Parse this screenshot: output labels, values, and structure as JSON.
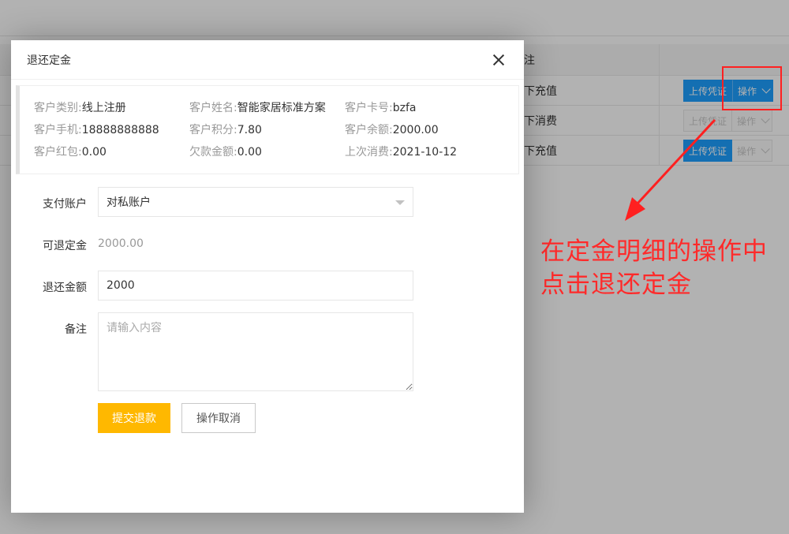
{
  "background": {
    "table_header_text": "注",
    "rows": [
      {
        "type_text": "下充值",
        "upload_label": "上传凭证",
        "op_label": "操作",
        "upload_enabled": true,
        "op_enabled": true
      },
      {
        "type_text": "下消费",
        "upload_label": "上传凭证",
        "op_label": "操作",
        "upload_enabled": false,
        "op_enabled": false
      },
      {
        "type_text": "下充值",
        "upload_label": "上传凭证",
        "op_label": "操作",
        "upload_enabled": true,
        "op_enabled": false
      }
    ]
  },
  "annotation": {
    "line1": "在定金明细的操作中",
    "line2": "点击退还定金",
    "color": "#ff2a2a"
  },
  "modal": {
    "title": "退还定金",
    "info": [
      {
        "label": "客户类别:",
        "value": "线上注册"
      },
      {
        "label": "客户姓名:",
        "value": "智能家居标准方案"
      },
      {
        "label": "客户卡号:",
        "value": "bzfa"
      },
      {
        "label": "客户手机:",
        "value": "18888888888"
      },
      {
        "label": "客户积分:",
        "value": "7.80"
      },
      {
        "label": "客户余额:",
        "value": "2000.00"
      },
      {
        "label": "客户红包:",
        "value": "0.00"
      },
      {
        "label": "欠款金额:",
        "value": "0.00"
      },
      {
        "label": "上次消费:",
        "value": "2021-10-12"
      }
    ],
    "form": {
      "pay_account_label": "支付账户",
      "pay_account_value": "对私账户",
      "refundable_label": "可退定金",
      "refundable_value": "2000.00",
      "refund_amount_label": "退还金额",
      "refund_amount_value": "2000",
      "remark_label": "备注",
      "remark_placeholder": "请输入内容"
    },
    "buttons": {
      "submit_label": "提交退款",
      "cancel_label": "操作取消"
    }
  },
  "colors": {
    "primary": "#1e9fff",
    "warning": "#ffb800",
    "annotation_red": "#ff2020"
  }
}
